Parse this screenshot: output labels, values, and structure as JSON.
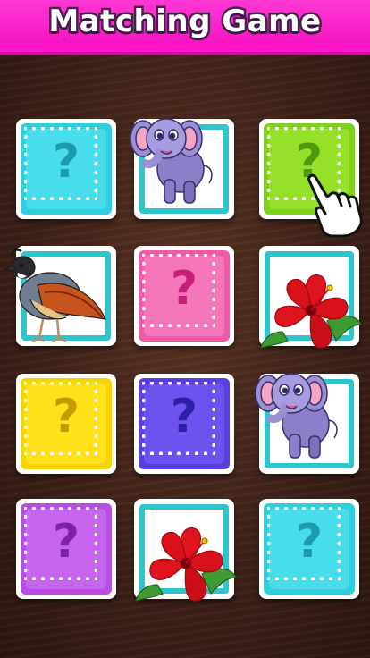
{
  "header": {
    "title": "Matching Game"
  },
  "cards": [
    {
      "row": 0,
      "col": 0,
      "state": "hidden",
      "color": "cyan",
      "mark": "?"
    },
    {
      "row": 0,
      "col": 1,
      "state": "revealed",
      "picture": "elephant"
    },
    {
      "row": 0,
      "col": 2,
      "state": "hidden",
      "color": "lime",
      "mark": "?"
    },
    {
      "row": 1,
      "col": 0,
      "state": "revealed",
      "picture": "quail"
    },
    {
      "row": 1,
      "col": 1,
      "state": "hidden",
      "color": "pink",
      "mark": "?"
    },
    {
      "row": 1,
      "col": 2,
      "state": "revealed",
      "picture": "hibiscus"
    },
    {
      "row": 2,
      "col": 0,
      "state": "hidden",
      "color": "yellow",
      "mark": "?"
    },
    {
      "row": 2,
      "col": 1,
      "state": "hidden",
      "color": "blue",
      "mark": "?"
    },
    {
      "row": 2,
      "col": 2,
      "state": "revealed",
      "picture": "elephant"
    },
    {
      "row": 3,
      "col": 0,
      "state": "hidden",
      "color": "purple",
      "mark": "?"
    },
    {
      "row": 3,
      "col": 1,
      "state": "revealed",
      "picture": "hibiscus"
    },
    {
      "row": 3,
      "col": 2,
      "state": "hidden",
      "color": "cyan",
      "mark": "?"
    }
  ],
  "palette": {
    "cyan": {
      "outer": "#2fd0dd",
      "inner": "#49dcea",
      "mark": "#1c9bb0"
    },
    "lime": {
      "outer": "#7fd11b",
      "inner": "#97e029",
      "mark": "#4f9a0c"
    },
    "pink": {
      "outer": "#f15aa8",
      "inner": "#f577b9",
      "mark": "#c51f77"
    },
    "yellow": {
      "outer": "#f5d500",
      "inner": "#ffe21a",
      "mark": "#c99a00"
    },
    "blue": {
      "outer": "#5a3fe0",
      "inner": "#6e52f0",
      "mark": "#2d1fa6"
    },
    "purple": {
      "outer": "#b74ee3",
      "inner": "#c865ef",
      "mark": "#7e22a8"
    }
  },
  "hint": {
    "icon": "pointing-hand-icon"
  }
}
